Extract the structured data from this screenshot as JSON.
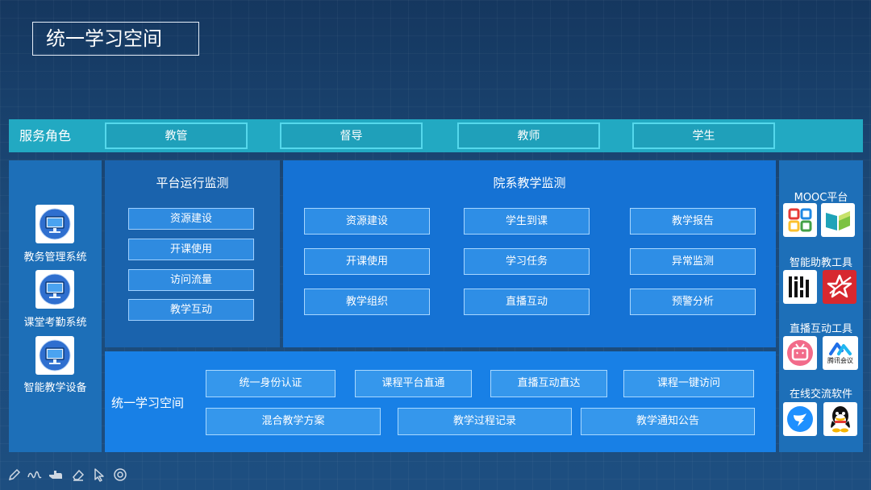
{
  "title": "统一学习空间",
  "roles": {
    "label": "服务角色",
    "items": [
      "教管",
      "督导",
      "教师",
      "学生"
    ]
  },
  "systems": [
    {
      "label": "教务管理系统",
      "icon": "monitor-icon"
    },
    {
      "label": "课堂考勤系统",
      "icon": "monitor-icon"
    },
    {
      "label": "智能教学设备",
      "icon": "monitor-icon"
    }
  ],
  "platform_monitor": {
    "title": "平台运行监测",
    "items": [
      "资源建设",
      "开课使用",
      "访问流量",
      "教学互动"
    ]
  },
  "dept_monitor": {
    "title": "院系教学监测",
    "items": [
      "资源建设",
      "学生到课",
      "教学报告",
      "开课使用",
      "学习任务",
      "异常监测",
      "教学组织",
      "直播互动",
      "预警分析"
    ]
  },
  "learning_space": {
    "label": "统一学习空间",
    "row1": [
      "统一身份认证",
      "课程平台直通",
      "直播互动直达",
      "课程一键访问"
    ],
    "row2": [
      "混合教学方案",
      "教学过程记录",
      "教学通知公告"
    ]
  },
  "tools": [
    {
      "heading": "MOOC平台",
      "icons": [
        "grid-app-icon",
        "book-app-icon"
      ]
    },
    {
      "heading": "智能助教工具",
      "icons": [
        "bars-app-icon",
        "star-app-icon"
      ]
    },
    {
      "heading": "直播互动工具",
      "icons": [
        "bilibili-icon",
        "tencent-meeting-icon"
      ]
    },
    {
      "heading": "在线交流软件",
      "icons": [
        "dingtalk-icon",
        "qq-icon"
      ]
    }
  ],
  "tencent_label": "腾讯会议",
  "toolbar": [
    "pen-icon",
    "ink-icon",
    "pointer-hand-icon",
    "eraser-icon",
    "arrow-cursor-icon",
    "settings-icon"
  ]
}
